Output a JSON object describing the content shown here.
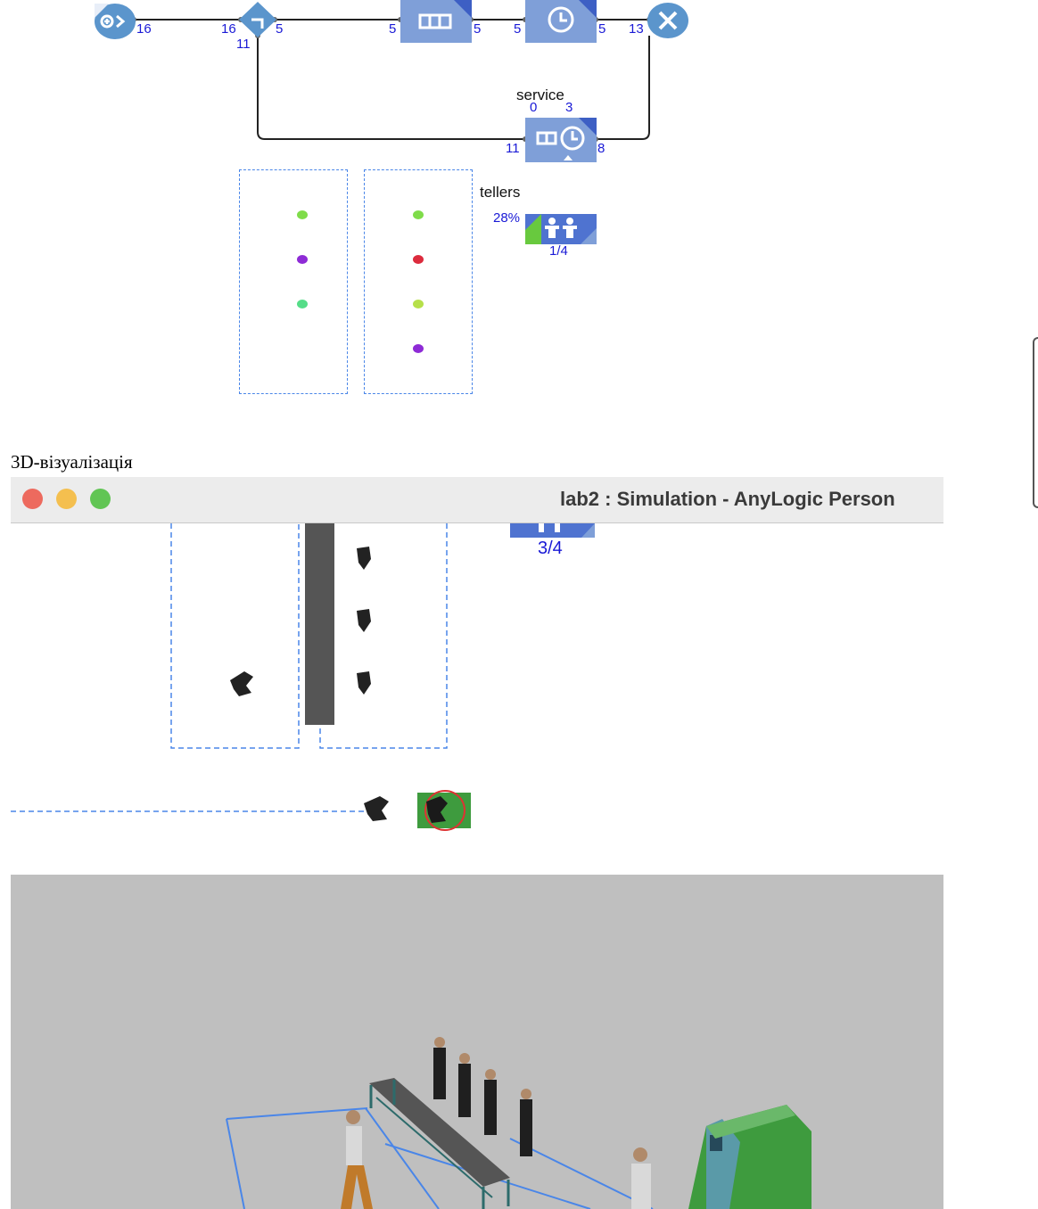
{
  "flowchart": {
    "source_out": "16",
    "select_in": "16",
    "select_out_true": "5",
    "select_out_false": "11",
    "queue_in": "5",
    "queue_out": "5",
    "delay_in": "5",
    "delay_out": "5",
    "sink_in": "13",
    "service_label": "service",
    "service_queue_count": "0",
    "service_capacity": "3",
    "service_in": "11",
    "service_out": "8",
    "tellers_label": "tellers",
    "tellers_utilization": "28%",
    "tellers_usage": "1/4"
  },
  "queue_dots": {
    "left": [
      "#7fdc4a",
      "#8e2bd6",
      "#55dd88"
    ],
    "right": [
      "#7fdc4a",
      "#dc2b3d",
      "#b6e04a",
      "#8e2bd6"
    ]
  },
  "caption": "3D-візуалізація",
  "window": {
    "title": "lab2 : Simulation - AnyLogic Person",
    "tellers_usage": "3/4"
  },
  "colors": {
    "block_blue": "#7f9fd8",
    "flow_blue": "#5b95cc",
    "zone_dash": "#4a86e8",
    "number_blue": "#1a1ad6",
    "atm_green": "#3e9b3e"
  }
}
